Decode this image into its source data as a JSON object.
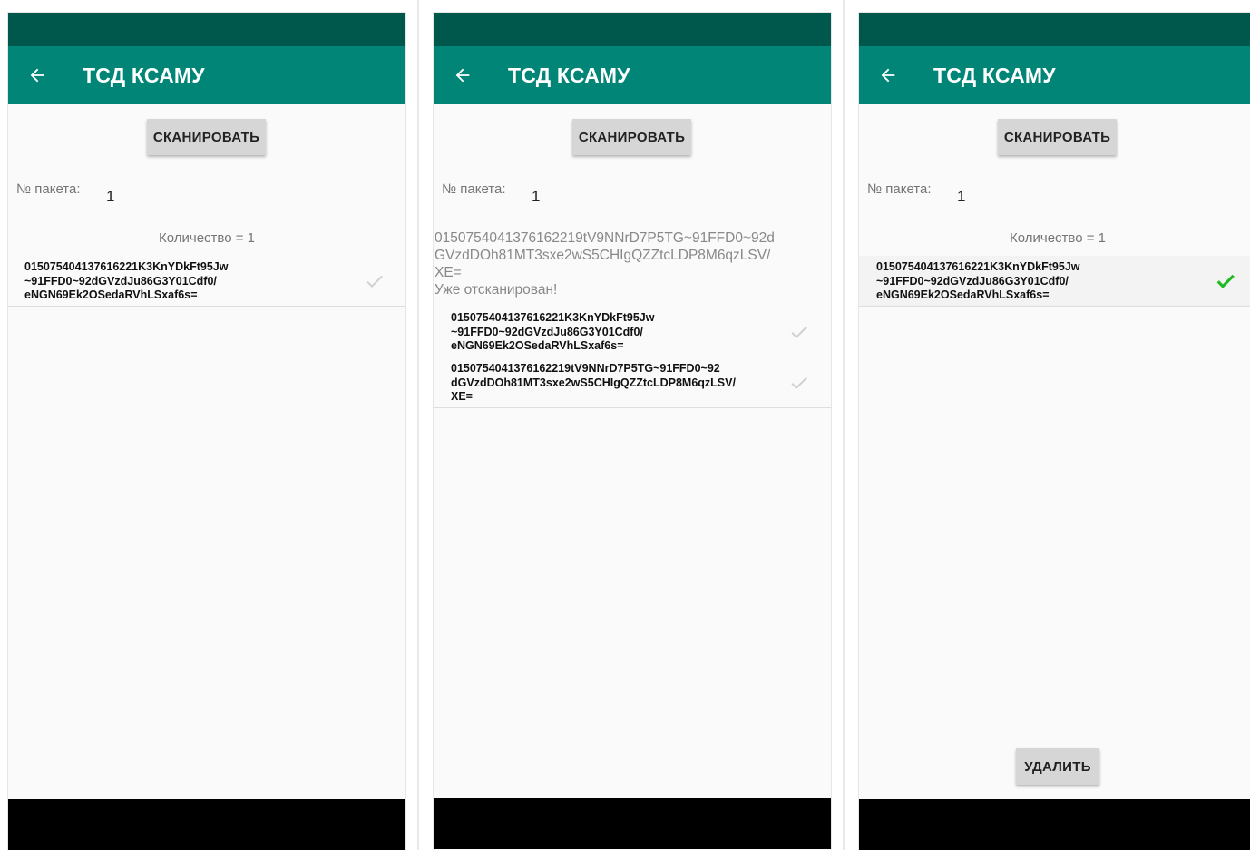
{
  "app": {
    "title": "ТСД КСАМУ",
    "scan_label": "СКАНИРОВАТЬ",
    "package_label": "№ пакета:",
    "delete_label": "УДАЛИТЬ"
  },
  "colors": {
    "status_bar": "#00574b",
    "app_bar": "#008577",
    "check_active": "#22bb22",
    "check_inactive": "#d0d0d0"
  },
  "screens": [
    {
      "package_value": "1",
      "count_text": "Количество = 1",
      "items": [
        {
          "code": "015075404137616221K3KnYDkFt95Jw\n~91FFD0~92dGVzdJu86G3Y01Cdf0/\neNGN69Ek2OSedaRVhLSxaf6s=",
          "checked": false
        }
      ]
    },
    {
      "package_value": "1",
      "message": "0150754041376162219tV9NNrD7P5TG~91FFD0~92d\nGVzdDOh81MT3sxe2wS5CHIgQZZtcLDP8M6qzLSV/\nXE=\nУже отсканирован!",
      "items": [
        {
          "code": "015075404137616221K3KnYDkFt95Jw\n~91FFD0~92dGVzdJu86G3Y01Cdf0/\neNGN69Ek2OSedaRVhLSxaf6s=",
          "checked": false
        },
        {
          "code": "0150754041376162219tV9NNrD7P5TG~91FFD0~92\ndGVzdDOh81MT3sxe2wS5CHIgQZZtcLDP8M6qzLSV/\nXE=",
          "checked": false
        }
      ]
    },
    {
      "package_value": "1",
      "count_text": "Количество = 1",
      "items": [
        {
          "code": "015075404137616221K3KnYDkFt95Jw\n~91FFD0~92dGVzdJu86G3Y01Cdf0/\neNGN69Ek2OSedaRVhLSxaf6s=",
          "checked": true
        }
      ]
    }
  ]
}
